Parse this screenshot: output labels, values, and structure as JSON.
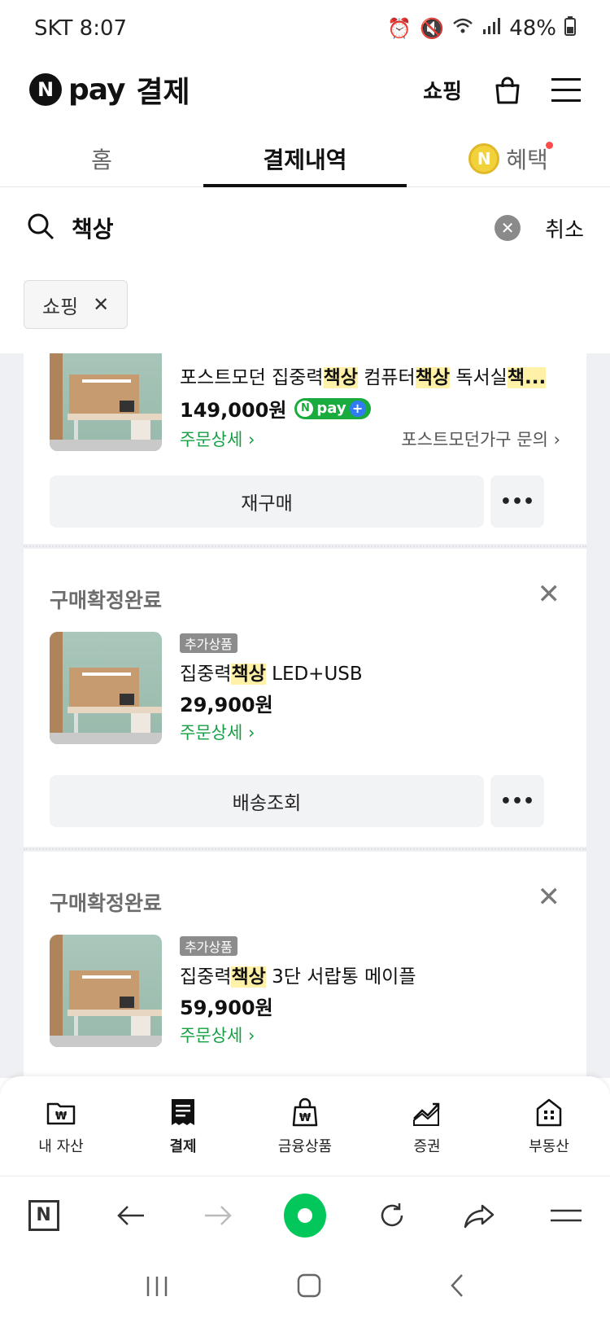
{
  "status_bar": {
    "carrier_time": "SKT 8:07",
    "battery": "48%",
    "icons": [
      "alarm-icon",
      "mute-icon",
      "wifi-icon",
      "signal-icon",
      "battery-icon"
    ]
  },
  "header": {
    "logo_badge": "N",
    "logo_pay": "pay",
    "title": "결제",
    "shopping": "쇼핑"
  },
  "tabs": [
    {
      "label": "홈"
    },
    {
      "label": "결제내역"
    },
    {
      "label": "혜택"
    }
  ],
  "search": {
    "query": "책상",
    "cancel": "취소"
  },
  "filter_chip": {
    "label": "쇼핑"
  },
  "orders": [
    {
      "title_parts": [
        "포스트모던 집중력",
        "책상",
        " 컴퓨터",
        "책상",
        " 독서실",
        "책..."
      ],
      "price": "149,000원",
      "badge": "pay",
      "detail_link": "주문상세",
      "store_link": "포스트모던가구 문의",
      "primary_button": "재구매",
      "more_button": "•••"
    },
    {
      "status": "구매확정완료",
      "tag": "추가상품",
      "title_parts": [
        "집중력",
        "책상",
        " LED+USB"
      ],
      "price": "29,900원",
      "detail_link": "주문상세",
      "primary_button": "배송조회",
      "more_button": "•••"
    },
    {
      "status": "구매확정완료",
      "tag": "추가상품",
      "title_parts": [
        "집중력",
        "책상",
        " 3단 서랍통 메이플"
      ],
      "price": "59,900원",
      "detail_link": "주문상세"
    }
  ],
  "bottom_nav": [
    {
      "label": "내 자산"
    },
    {
      "label": "결제"
    },
    {
      "label": "금융상품"
    },
    {
      "label": "증권"
    },
    {
      "label": "부동산"
    }
  ],
  "browser_bar": {
    "home_badge": "N"
  },
  "colors": {
    "accent_green": "#03c75a",
    "link_green": "#14a043",
    "highlight": "#fff2a8",
    "list_bg": "#eef0f3"
  }
}
